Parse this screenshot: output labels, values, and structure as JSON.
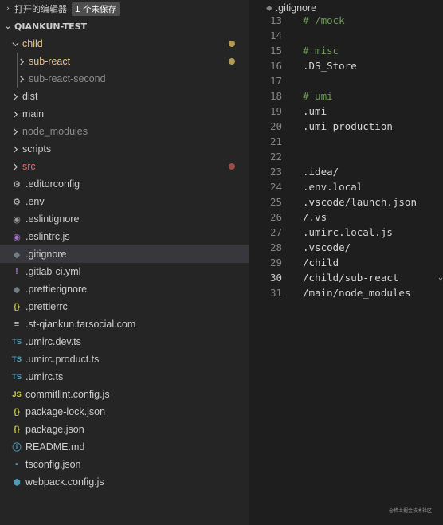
{
  "explorer": {
    "open_editors": {
      "title": "打开的编辑器",
      "badge": "1 个未保存"
    },
    "root_folder": "QIANKUN-TEST",
    "items": [
      {
        "label": "child",
        "kind": "folder",
        "expanded": true,
        "depth": 0,
        "color": "#e2c08d",
        "dot": "#b19a55"
      },
      {
        "label": "sub-react",
        "kind": "folder",
        "expanded": false,
        "depth": 1,
        "color": "#e2c08d",
        "dot": "#b19a55"
      },
      {
        "label": "sub-react-second",
        "kind": "folder",
        "expanded": false,
        "depth": 1,
        "color": "#8c8c8c"
      },
      {
        "label": "dist",
        "kind": "folder",
        "expanded": false,
        "depth": 0,
        "color": "#cccccc"
      },
      {
        "label": "main",
        "kind": "folder",
        "expanded": false,
        "depth": 0,
        "color": "#cccccc"
      },
      {
        "label": "node_modules",
        "kind": "folder",
        "expanded": false,
        "depth": 0,
        "color": "#8c8c8c"
      },
      {
        "label": "scripts",
        "kind": "folder",
        "expanded": false,
        "depth": 0,
        "color": "#cccccc"
      },
      {
        "label": "src",
        "kind": "folder",
        "expanded": false,
        "depth": 0,
        "color": "#e06c5a",
        "dot": "#9c4d43"
      },
      {
        "label": ".editorconfig",
        "kind": "file",
        "icon": "gear-icon",
        "glyph": "⚙",
        "icon_color": "#c5c5c5",
        "color": "#cccccc"
      },
      {
        "label": ".env",
        "kind": "file",
        "icon": "gear-icon",
        "glyph": "⚙",
        "icon_color": "#c5c5c5",
        "color": "#cccccc"
      },
      {
        "label": ".eslintignore",
        "kind": "file",
        "icon": "eslint-icon",
        "glyph": "◉",
        "icon_color": "#9a9a9a",
        "color": "#cccccc"
      },
      {
        "label": ".eslintrc.js",
        "kind": "file",
        "icon": "eslint-icon",
        "glyph": "◉",
        "icon_color": "#a074c4",
        "color": "#cccccc"
      },
      {
        "label": ".gitignore",
        "kind": "file",
        "icon": "git-icon",
        "glyph": "◆",
        "icon_color": "#6d8086",
        "color": "#cccccc",
        "selected": true
      },
      {
        "label": ".gitlab-ci.yml",
        "kind": "file",
        "icon": "yaml-icon",
        "glyph": "!",
        "icon_color": "#a074c4",
        "color": "#cccccc"
      },
      {
        "label": ".prettierignore",
        "kind": "file",
        "icon": "prettier-icon",
        "glyph": "◆",
        "icon_color": "#6d8086",
        "color": "#cccccc"
      },
      {
        "label": ".prettierrc",
        "kind": "file",
        "icon": "json-icon",
        "glyph": "{}",
        "icon_color": "#cbcb41",
        "color": "#cccccc"
      },
      {
        "label": ".st-qiankun.tarsocial.com",
        "kind": "file",
        "icon": "text-icon",
        "glyph": "≡",
        "icon_color": "#c5c5c5",
        "color": "#cccccc"
      },
      {
        "label": ".umirc.dev.ts",
        "kind": "file",
        "icon": "typescript-icon",
        "glyph": "TS",
        "icon_color": "#519aba",
        "color": "#cccccc"
      },
      {
        "label": ".umirc.product.ts",
        "kind": "file",
        "icon": "typescript-icon",
        "glyph": "TS",
        "icon_color": "#519aba",
        "color": "#cccccc"
      },
      {
        "label": ".umirc.ts",
        "kind": "file",
        "icon": "typescript-icon",
        "glyph": "TS",
        "icon_color": "#519aba",
        "color": "#cccccc"
      },
      {
        "label": "commitlint.config.js",
        "kind": "file",
        "icon": "javascript-icon",
        "glyph": "JS",
        "icon_color": "#cbcb41",
        "color": "#cccccc"
      },
      {
        "label": "package-lock.json",
        "kind": "file",
        "icon": "json-icon",
        "glyph": "{}",
        "icon_color": "#cbcb41",
        "color": "#cccccc"
      },
      {
        "label": "package.json",
        "kind": "file",
        "icon": "json-icon",
        "glyph": "{}",
        "icon_color": "#cbcb41",
        "color": "#cccccc"
      },
      {
        "label": "README.md",
        "kind": "file",
        "icon": "info-icon",
        "glyph": "ⓘ",
        "icon_color": "#519aba",
        "color": "#cccccc"
      },
      {
        "label": "tsconfig.json",
        "kind": "file",
        "icon": "tsconfig-icon",
        "glyph": "▪",
        "icon_color": "#519aba",
        "color": "#cccccc"
      },
      {
        "label": "webpack.config.js",
        "kind": "file",
        "icon": "webpack-icon",
        "glyph": "⬢",
        "icon_color": "#519aba",
        "color": "#cccccc"
      }
    ]
  },
  "editor": {
    "filename": ".gitignore",
    "active_line": 30,
    "lines": [
      {
        "n": 13,
        "text": "# /mock",
        "comment": true
      },
      {
        "n": 14,
        "text": ""
      },
      {
        "n": 15,
        "text": "# misc",
        "comment": true
      },
      {
        "n": 16,
        "text": ".DS_Store"
      },
      {
        "n": 17,
        "text": ""
      },
      {
        "n": 18,
        "text": "# umi",
        "comment": true
      },
      {
        "n": 19,
        "text": ".umi"
      },
      {
        "n": 20,
        "text": ".umi-production"
      },
      {
        "n": 21,
        "text": ""
      },
      {
        "n": 22,
        "text": ""
      },
      {
        "n": 23,
        "text": ".idea/"
      },
      {
        "n": 24,
        "text": ".env.local"
      },
      {
        "n": 25,
        "text": ".vscode/launch.json"
      },
      {
        "n": 26,
        "text": "/.vs"
      },
      {
        "n": 27,
        "text": ".umirc.local.js"
      },
      {
        "n": 28,
        "text": ".vscode/"
      },
      {
        "n": 29,
        "text": "/child"
      },
      {
        "n": 30,
        "text": "/child/sub-react"
      },
      {
        "n": 31,
        "text": "/main/node_modules"
      }
    ]
  },
  "watermark": "@稀土掘金技术社区"
}
